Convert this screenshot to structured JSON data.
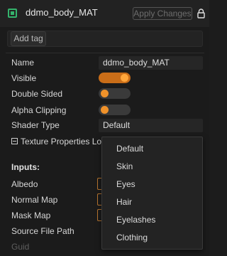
{
  "header": {
    "title": "ddmo_body_MAT",
    "apply_label": "Apply Changes",
    "material_icon": "material-icon",
    "lock_icon": "lock-icon",
    "accent_color": "#34b36c"
  },
  "tags": {
    "add_tag_label": "Add tag"
  },
  "properties": {
    "name": {
      "label": "Name",
      "value": "ddmo_body_MAT"
    },
    "visible": {
      "label": "Visible",
      "on": true
    },
    "double_sided": {
      "label": "Double Sided",
      "on": false
    },
    "alpha_clipping": {
      "label": "Alpha Clipping",
      "on": false
    },
    "shader_type": {
      "label": "Shader Type",
      "value": "Default"
    },
    "texture_properties": {
      "label": "Texture Properties Lo"
    }
  },
  "inputs": {
    "heading": "Inputs:",
    "albedo": "Albedo",
    "normal_map": "Normal Map",
    "mask_map": "Mask Map",
    "source_file_path": "Source File Path",
    "guid": "Guid"
  },
  "shader_dropdown": {
    "options": [
      "Default",
      "Skin",
      "Eyes",
      "Hair",
      "Eyelashes",
      "Clothing"
    ]
  },
  "colors": {
    "toggle_on": "#c96d18",
    "knob": "#ffa63b",
    "slot_border": "#b87630"
  }
}
